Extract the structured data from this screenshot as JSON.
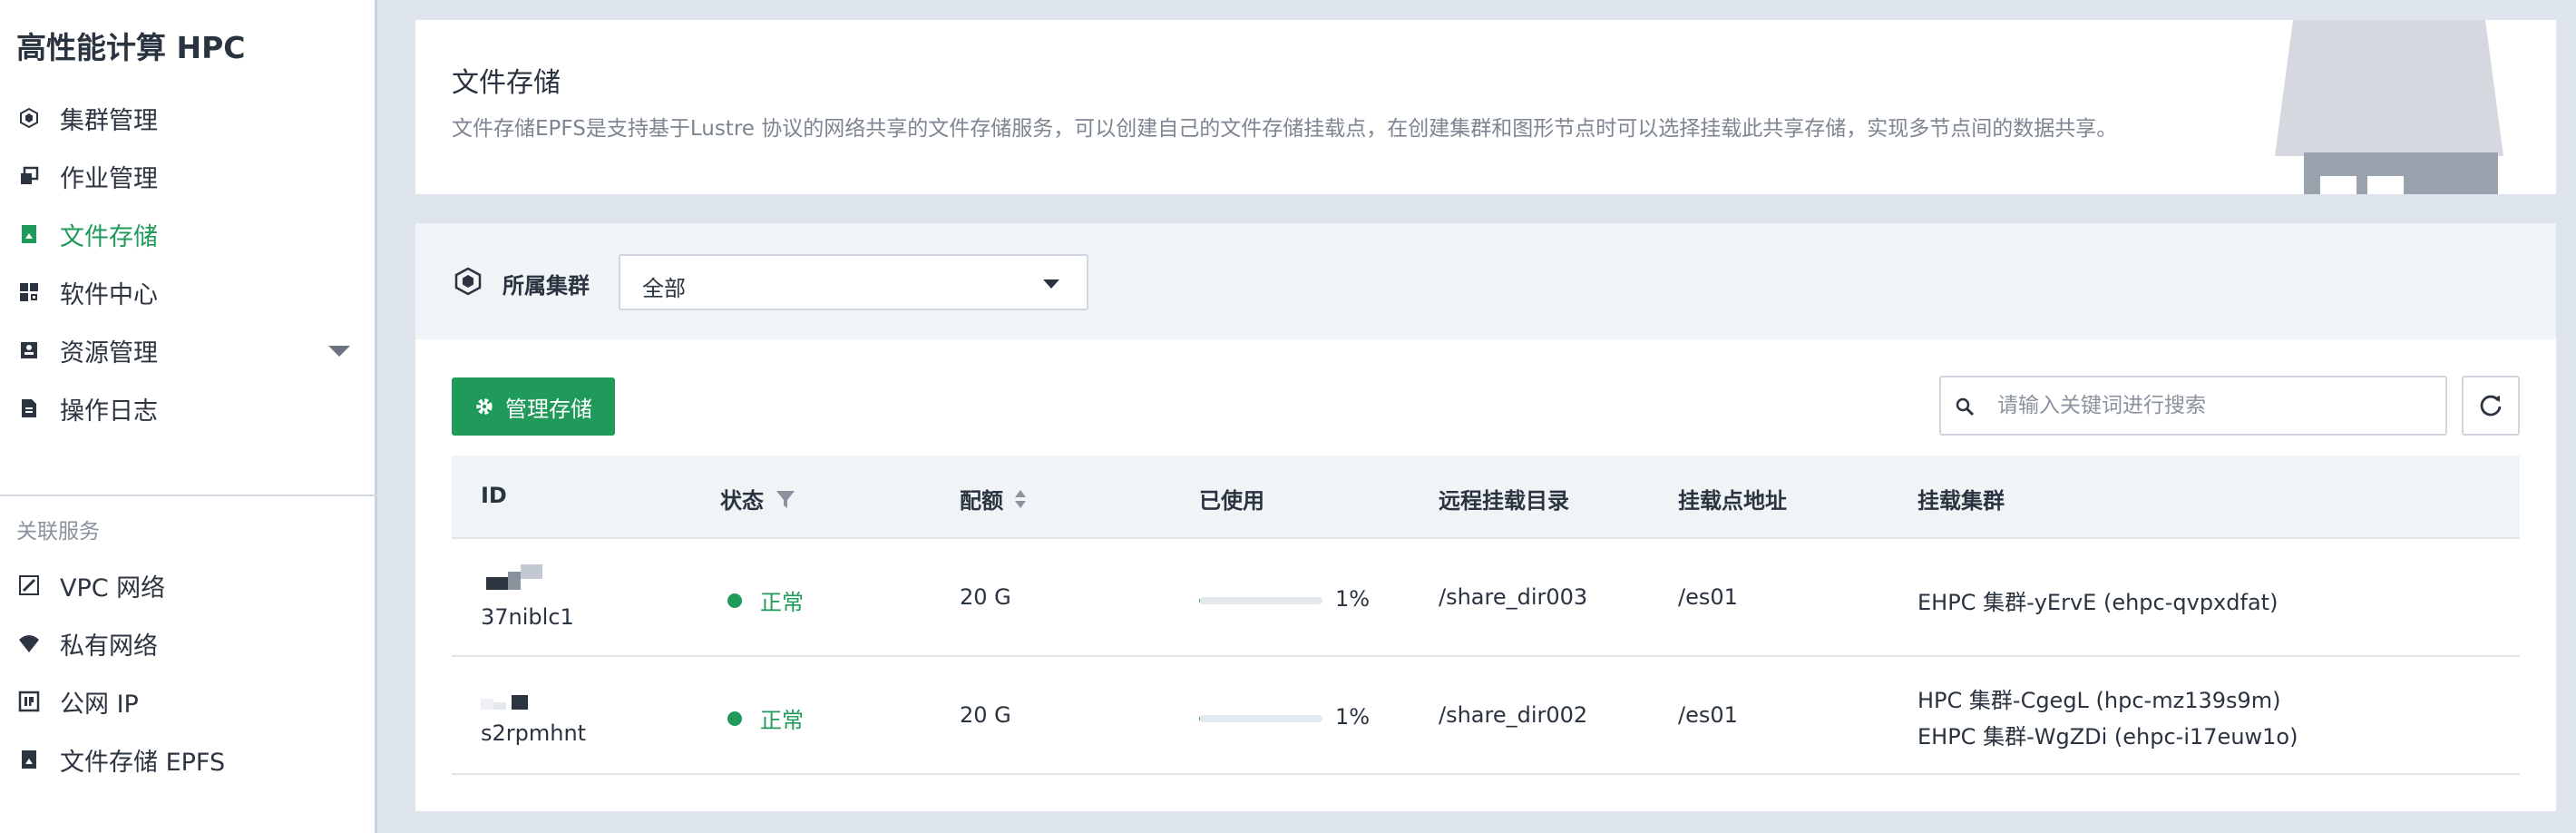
{
  "app": {
    "title": "高性能计算 HPC"
  },
  "sidebar": {
    "items": [
      {
        "label": "集群管理",
        "icon": "cluster-icon"
      },
      {
        "label": "作业管理",
        "icon": "jobs-icon"
      },
      {
        "label": "文件存储",
        "icon": "file-storage-icon",
        "active": true
      },
      {
        "label": "软件中心",
        "icon": "software-grid-icon"
      },
      {
        "label": "资源管理",
        "icon": "resource-icon",
        "expandable": true
      },
      {
        "label": "操作日志",
        "icon": "log-icon"
      }
    ],
    "related_label": "关联服务",
    "related": [
      {
        "label": "VPC 网络",
        "icon": "vpc-icon"
      },
      {
        "label": "私有网络",
        "icon": "private-network-icon"
      },
      {
        "label": "公网 IP",
        "icon": "public-ip-icon"
      },
      {
        "label": "文件存储 EPFS",
        "icon": "epfs-icon"
      }
    ]
  },
  "header": {
    "title": "文件存储",
    "description": "文件存储EPFS是支持基于Lustre 协议的网络共享的文件存储服务，可以创建自己的文件存储挂载点，在创建集群和图形节点时可以选择挂载此共享存储，实现多节点间的数据共享。"
  },
  "filter": {
    "label": "所属集群",
    "selected": "全部"
  },
  "toolbar": {
    "manage_label": "管理存储",
    "search_placeholder": "请输入关键词进行搜索"
  },
  "table": {
    "columns": [
      "ID",
      "状态",
      "配额",
      "已使用",
      "远程挂载目录",
      "挂载点地址",
      "挂载集群"
    ],
    "rows": [
      {
        "id": "37niblc1",
        "status": "正常",
        "quota": "20 G",
        "used_percent": 1,
        "used_label": "1%",
        "remote_dir": "/share_dir003",
        "mount_addr": "/es01",
        "clusters": [
          "EHPC 集群-yErvE (ehpc-qvpxdfat)"
        ]
      },
      {
        "id": "s2rpmhnt",
        "status": "正常",
        "quota": "20 G",
        "used_percent": 1,
        "used_label": "1%",
        "remote_dir": "/share_dir002",
        "mount_addr": "/es01",
        "clusters": [
          "HPC 集群-CgegL (hpc-mz139s9m)",
          "EHPC 集群-WgZDi (ehpc-i17euw1o)"
        ]
      }
    ]
  },
  "colors": {
    "accent": "#1f9a5a",
    "background": "#dde4ec",
    "text": "#2c3440"
  }
}
